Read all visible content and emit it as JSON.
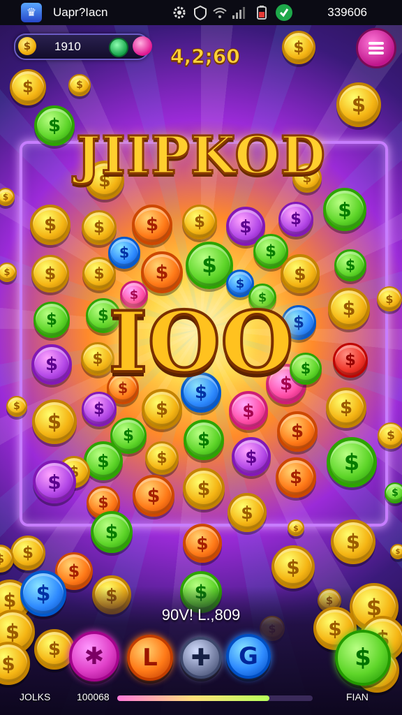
{
  "status_bar": {
    "app_icon_glyph": "♛",
    "app_title": "Uapr?Iacn",
    "right_value": "339606",
    "icons": [
      "settings-icon",
      "shield-icon",
      "wifi-icon",
      "signal-icon",
      "battery-icon",
      "app-badge-icon"
    ]
  },
  "hud": {
    "balance_value": "1910",
    "coin_glyph": "$",
    "top_score": "4,2;60"
  },
  "board": {
    "title": "JIIPKOD",
    "win_amount": "IOO"
  },
  "coin_palette": {
    "gold": "#f5b514",
    "green": "#5fd62a",
    "purple": "#b54ae8",
    "blue": "#2f8bff",
    "pink": "#ff4fa8",
    "orange": "#ff7a18",
    "red": "#f0362a"
  },
  "bottom": {
    "bet_text": "90V! L.,809",
    "actions": [
      {
        "name": "bonus-button",
        "glyph": "✱",
        "color": "#e040c8"
      },
      {
        "name": "level-button",
        "glyph": "L",
        "color": "#ff7a18"
      },
      {
        "name": "add-button",
        "glyph": "✚",
        "color": "#7a84a8"
      },
      {
        "name": "refresh-button",
        "glyph": "G",
        "color": "#2f8bff"
      },
      {
        "name": "spin-button",
        "glyph": "$",
        "color": "#5fd62a"
      }
    ],
    "footer_left": "JOLKS",
    "footer_center": "100068",
    "footer_right": "FIAN",
    "progress_fraction": 0.78
  }
}
